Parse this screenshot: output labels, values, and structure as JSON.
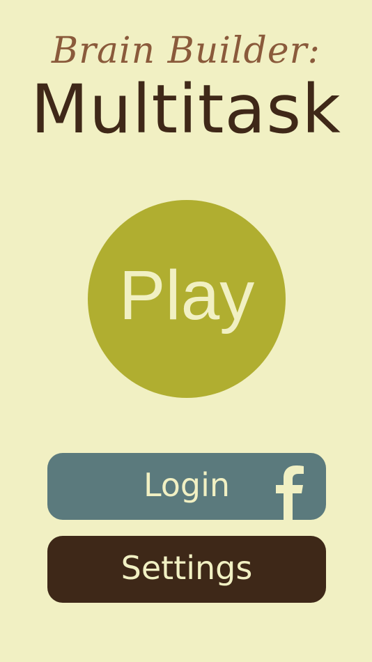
{
  "header": {
    "subtitle": "Brain Builder:",
    "title": "Multitask"
  },
  "play": {
    "label": "Play"
  },
  "login": {
    "label": "Login",
    "icon": "facebook-f-icon"
  },
  "settings": {
    "label": "Settings"
  },
  "colors": {
    "background": "#f1f0c3",
    "subtitle": "#8a5a3b",
    "title": "#3f2818",
    "play_button": "#b0ae30",
    "login_button": "#5b7a7d",
    "settings_button": "#3e2818",
    "button_text": "#f1f0c3"
  }
}
